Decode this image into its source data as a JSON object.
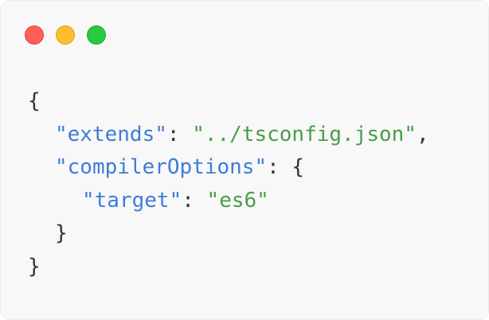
{
  "window": {
    "controls": {
      "close_color": "#ff5f56",
      "minimize_color": "#ffbd2e",
      "maximize_color": "#27c93f"
    }
  },
  "code": {
    "colors": {
      "key": "#3f7cdb",
      "string": "#4a9c4a",
      "punctuation": "#333333"
    },
    "lines": {
      "l1": {
        "open": "{"
      },
      "l2": {
        "key": "\"extends\"",
        "colon": ": ",
        "value": "\"../tsconfig.json\"",
        "comma": ","
      },
      "l3": {
        "key": "\"compilerOptions\"",
        "colon": ": ",
        "open": "{"
      },
      "l4": {
        "key": "\"target\"",
        "colon": ": ",
        "value": "\"es6\""
      },
      "l5": {
        "close": "}"
      },
      "l6": {
        "close": "}"
      }
    }
  }
}
